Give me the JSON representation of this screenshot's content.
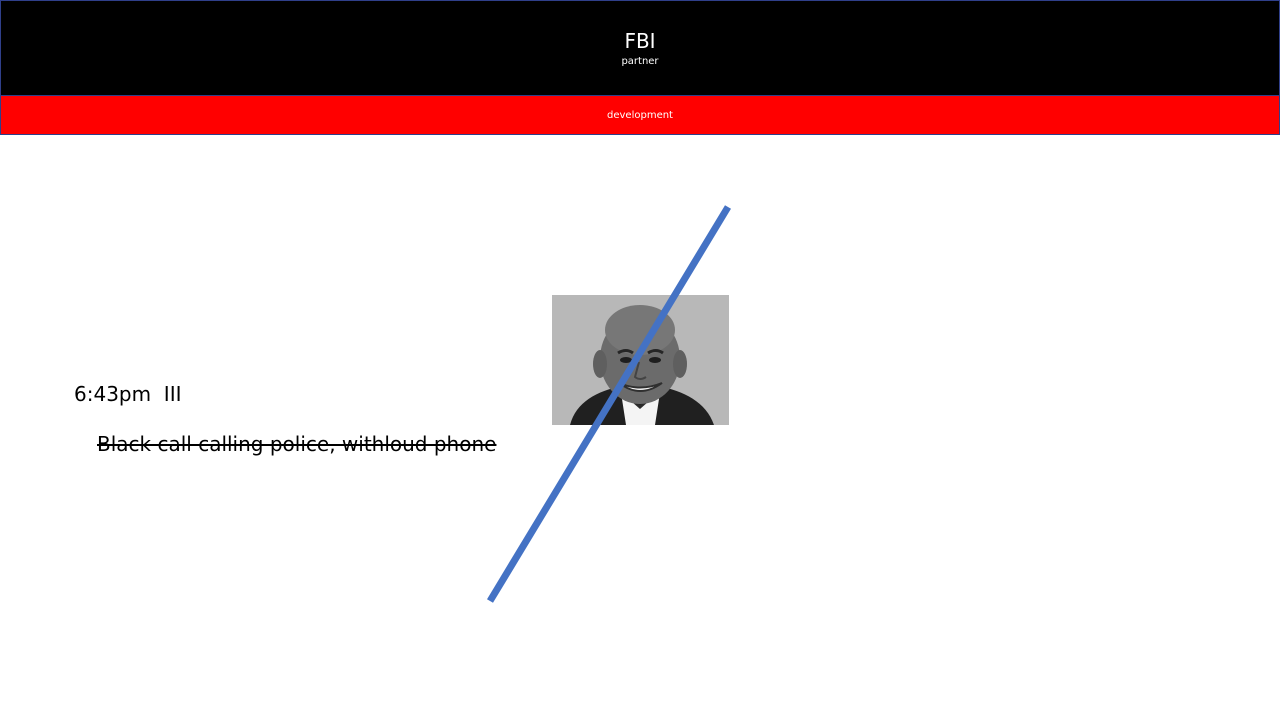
{
  "header": {
    "title": "FBI",
    "subtitle": "partner"
  },
  "banner": {
    "label": "development"
  },
  "content": {
    "time_text": "6:43pm  III",
    "struck_text": "Black call calling police, withloud phone"
  },
  "colors": {
    "header_bg": "#000000",
    "banner_bg": "#ff0000",
    "line": "#4472c4",
    "border": "#2f3f8a"
  },
  "icons": {
    "photo": "portrait-photo-icon",
    "line": "diagonal-line-shape"
  }
}
